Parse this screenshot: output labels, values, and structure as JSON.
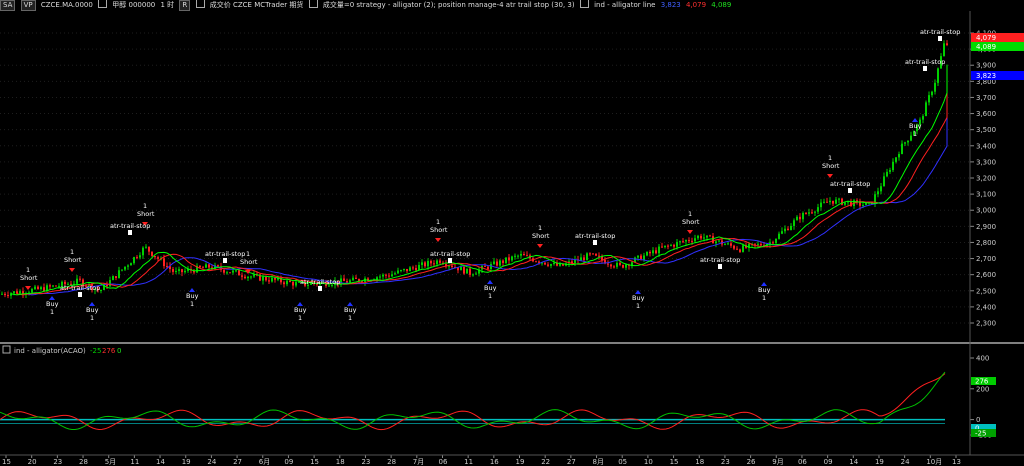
{
  "toolbar": {
    "sa_label": "SA",
    "vp_label": "VP",
    "symbol": "CZCE.MA.0000",
    "name": "甲醇 000000",
    "interval": "1 时",
    "r_label": "R",
    "exchange_info": "成交价  CZCE  MCTrader  期货",
    "study_info": "成交量=0  strategy - alligator (2); position manage-4 atr trail stop (30, 3)",
    "indicator_name": "ind - alligator line",
    "values": [
      "3,823",
      "4,079",
      "4,089"
    ]
  },
  "lower_pane": {
    "title": "ind - alligator(ACAO)",
    "values": [
      "-25",
      "276",
      "0"
    ]
  },
  "price_axis": {
    "ticks": [
      "4,100",
      "4,000",
      "3,900",
      "3,800",
      "3,700",
      "3,600",
      "3,500",
      "3,400",
      "3,300",
      "3,200",
      "3,100",
      "3,000",
      "2,900",
      "2,800",
      "2,700",
      "2,600",
      "2,500",
      "2,400",
      "2,300"
    ],
    "markers": [
      {
        "label": "4,079",
        "color": "#ff2020"
      },
      {
        "label": "4,089",
        "color": "#00dd00"
      },
      {
        "label": "3,823",
        "color": "#0000ff"
      }
    ]
  },
  "indicator_axis": {
    "ticks": [
      "400",
      "200",
      "0",
      "-100"
    ],
    "markers": [
      {
        "label": "276",
        "color": "#00cc00"
      },
      {
        "label": "0",
        "color": "#00c0c0"
      },
      {
        "label": "-25",
        "color": "#00a000"
      }
    ]
  },
  "date_axis": [
    "15",
    "20",
    "23",
    "28",
    "5月",
    "11",
    "14",
    "19",
    "24",
    "27",
    "6月",
    "09",
    "15",
    "18",
    "23",
    "28",
    "7月",
    "06",
    "11",
    "16",
    "19",
    "22",
    "27",
    "8月",
    "05",
    "10",
    "15",
    "18",
    "23",
    "26",
    "9月",
    "06",
    "09",
    "14",
    "19",
    "24",
    "10月",
    "13"
  ],
  "signal_labels": {
    "buy": "Buy",
    "short": "Short",
    "stop": "atr-trail-stop",
    "one": "1"
  },
  "colors": {
    "background": "#000000",
    "up_bar": "#00d000",
    "down_bar": "#ff2020",
    "jaw": "#3030ff",
    "teeth": "#ff2020",
    "lips": "#00ff00",
    "grid": "#1e1e1e"
  }
}
